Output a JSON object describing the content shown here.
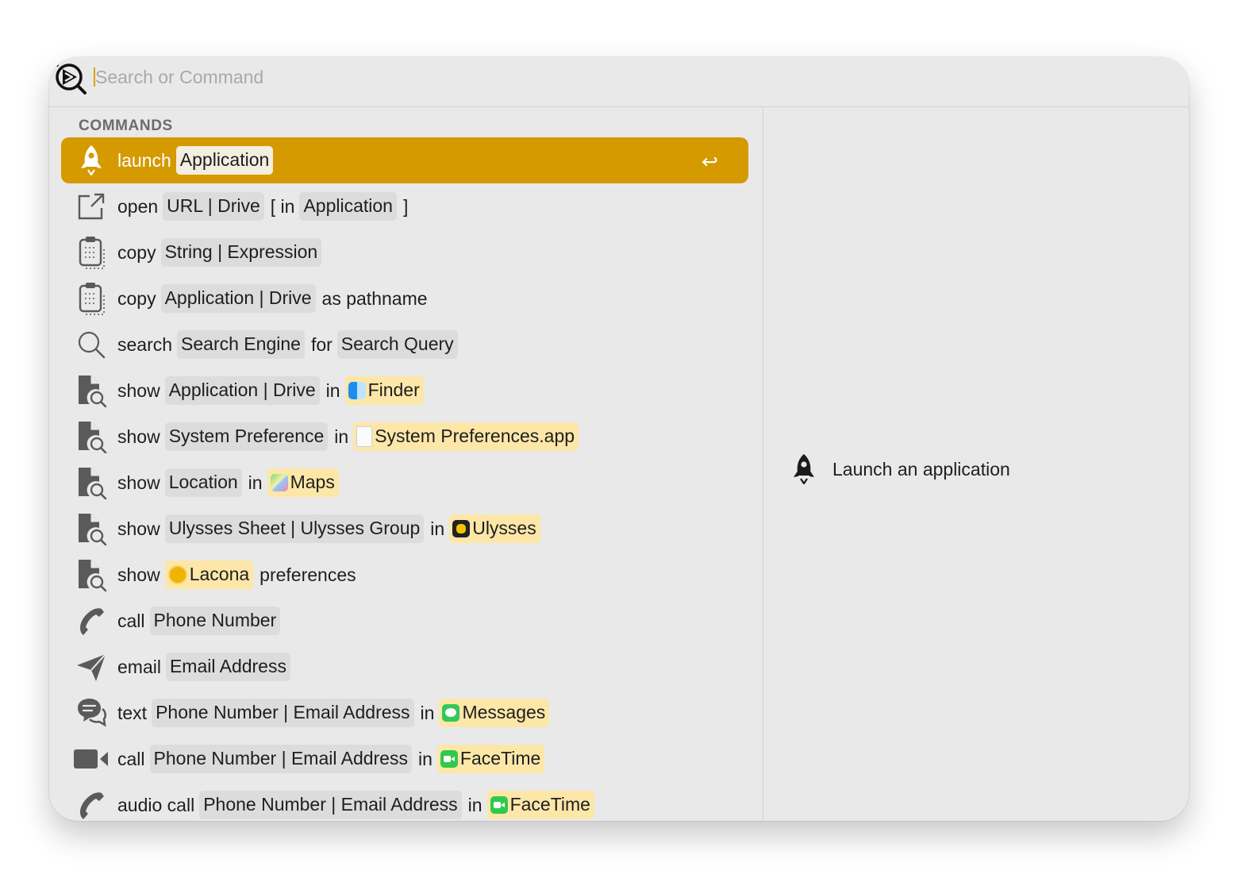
{
  "search": {
    "placeholder": "Search or Command",
    "value": ""
  },
  "section_title": "COMMANDS",
  "enter_glyph": "↩",
  "rows": [
    {
      "icon": "rocket-icon",
      "verb": "launch",
      "tok1": "Application",
      "selected": true
    },
    {
      "icon": "open-external-icon",
      "verb": "open",
      "tok1": "URL | Drive",
      "w1": "[ in",
      "tok2": "Application",
      "w2": "]"
    },
    {
      "icon": "clipboard-icon",
      "verb": "copy",
      "tok1": "String | Expression"
    },
    {
      "icon": "clipboard-icon",
      "verb": "copy",
      "tok1": "Application | Drive",
      "w1": "as pathname"
    },
    {
      "icon": "magnifier-icon",
      "verb": "search",
      "tok1": "Search Engine",
      "w1": "for",
      "tok2": "Search Query"
    },
    {
      "icon": "document-search-icon",
      "verb": "show",
      "tok1": "Application | Drive",
      "w1": "in",
      "app": "Finder",
      "app_icon": "finder-app-icon"
    },
    {
      "icon": "document-search-icon",
      "verb": "show",
      "tok1": "System Preference",
      "w1": "in",
      "app": "System Preferences.app",
      "app_icon": "blank-document-icon"
    },
    {
      "icon": "document-search-icon",
      "verb": "show",
      "tok1": "Location",
      "w1": "in",
      "app": "Maps",
      "app_icon": "maps-app-icon"
    },
    {
      "icon": "document-search-icon",
      "verb": "show",
      "tok1": "Ulysses Sheet | Ulysses Group",
      "w1": "in",
      "app": "Ulysses",
      "app_icon": "ulysses-app-icon"
    },
    {
      "icon": "document-search-icon",
      "verb": "show",
      "app": "Lacona",
      "app_icon": "lacona-app-icon",
      "w_after": "preferences"
    },
    {
      "icon": "phone-icon",
      "verb": "call",
      "tok1": "Phone Number"
    },
    {
      "icon": "paper-plane-icon",
      "verb": "email",
      "tok1": "Email Address"
    },
    {
      "icon": "chat-bubbles-icon",
      "verb": "text",
      "tok1": "Phone Number | Email Address",
      "w1": "in",
      "app": "Messages",
      "app_icon": "messages-app-icon"
    },
    {
      "icon": "video-camera-icon",
      "verb": "call",
      "tok1": "Phone Number | Email Address",
      "w1": "in",
      "app": "FaceTime",
      "app_icon": "facetime-app-icon"
    },
    {
      "icon": "phone-icon",
      "verb": "audio call",
      "tok1": "Phone Number | Email Address",
      "w1": "in",
      "app": "FaceTime",
      "app_icon": "facetime-app-icon"
    }
  ],
  "detail": {
    "icon": "rocket-icon",
    "text": "Launch an application"
  },
  "colors": {
    "accent": "#d49a00",
    "token": "#dcdcdc",
    "app_token": "#fde7a8",
    "background": "#e9e9e9"
  }
}
